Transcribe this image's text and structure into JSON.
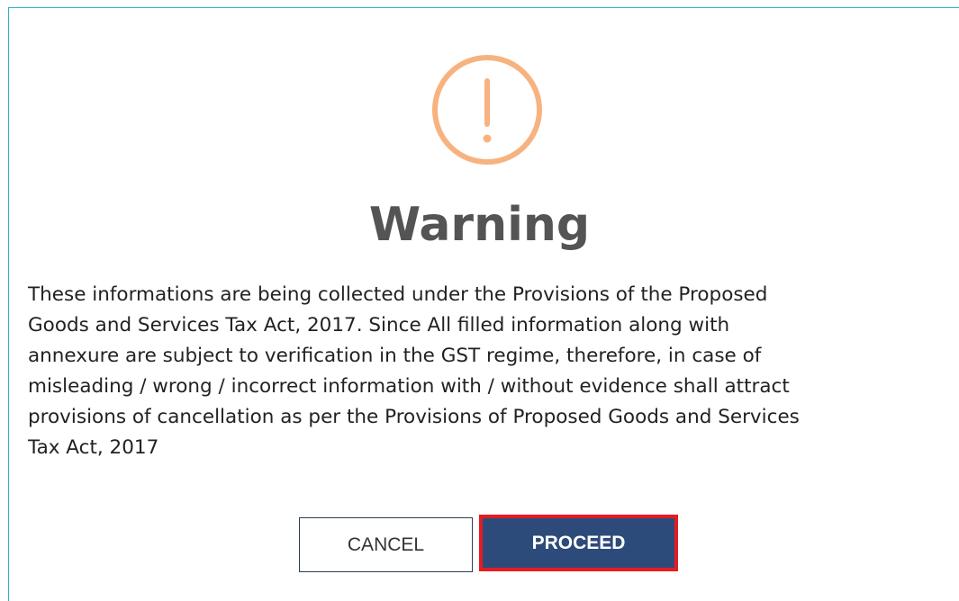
{
  "dialog": {
    "icon": "exclamation-circle-icon",
    "icon_color": "#f7b37f",
    "title": "Warning",
    "message": "These informations are being collected under the Provisions of the Proposed\nGoods and Services Tax Act, 2017. Since All filled information along with\nannexure are subject to verification in the GST regime, therefore, in case of\nmisleading / wrong / incorrect information with / without evidence shall attract\nprovisions of cancellation as per the Provisions of Proposed Goods and Services\nTax Act, 2017",
    "buttons": {
      "cancel_label": "CANCEL",
      "proceed_label": "PROCEED"
    },
    "colors": {
      "border": "#2ab3c4",
      "title": "#545454",
      "proceed_bg": "#2d4b7a",
      "highlight": "#e31b23"
    }
  }
}
